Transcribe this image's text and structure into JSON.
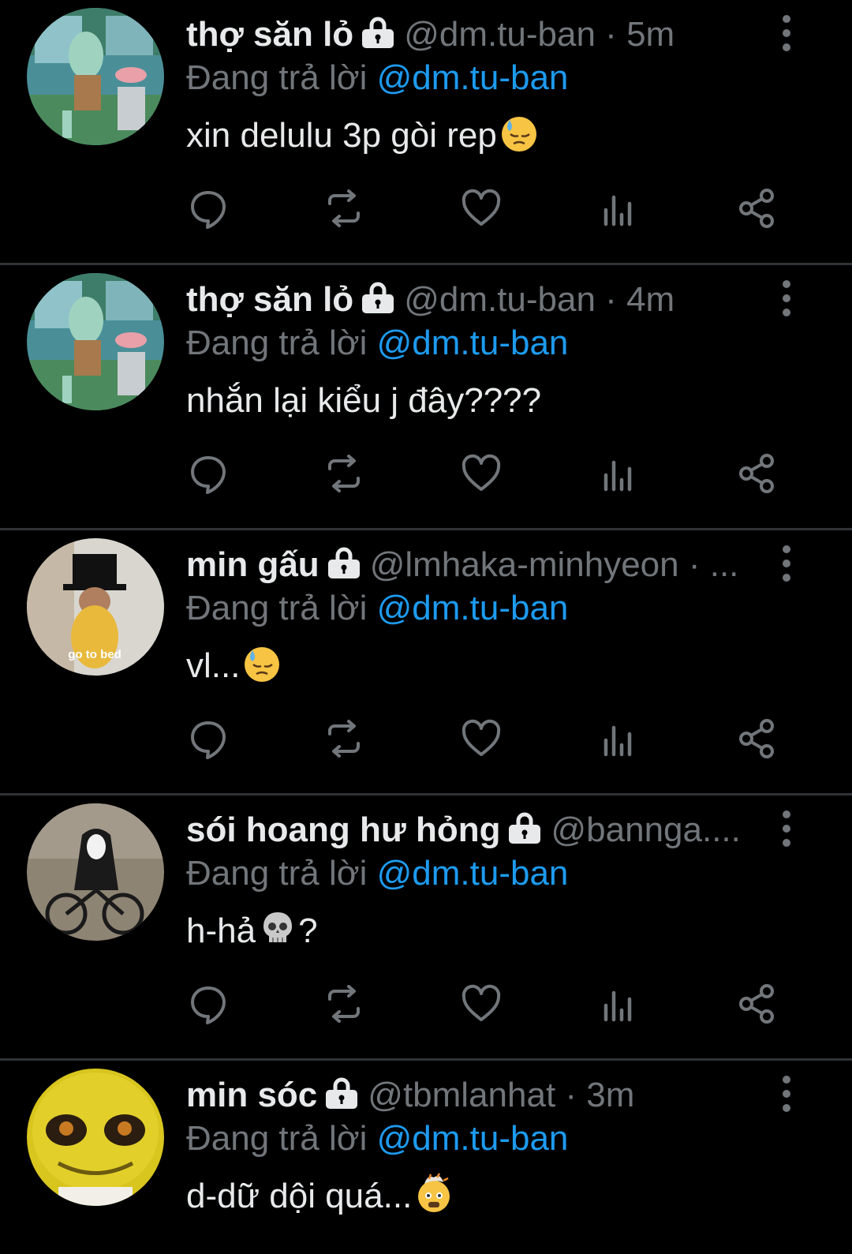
{
  "replying_prefix": "Đang trả lời ",
  "tweets": [
    {
      "name": "thợ săn lỏ",
      "handle_time": "@dm.tu-ban · 5m",
      "replying_to": "@dm.tu-ban",
      "text": "xin delulu 3p gòi rep",
      "emoji": "sad-sweat-face"
    },
    {
      "name": "thợ săn lỏ",
      "handle_time": "@dm.tu-ban · 4m",
      "replying_to": "@dm.tu-ban",
      "text": "nhắn lại kiểu j đây????",
      "emoji": ""
    },
    {
      "name": "min gấu",
      "handle_time": "@lmhaka-minhyeon · ...",
      "replying_to": "@dm.tu-ban",
      "text": "vl...",
      "emoji": "sad-sweat-face",
      "avatar_caption": "go to bed"
    },
    {
      "name": "sói hoang hư hỏng",
      "handle_time": "@bannga....",
      "replying_to": "@dm.tu-ban",
      "text": "h-hả",
      "text_after": "?",
      "emoji": "skull"
    },
    {
      "name": "min sóc",
      "handle_time": "@tbmlanhat · 3m",
      "replying_to": "@dm.tu-ban",
      "text": "d-dữ dội quá...",
      "emoji": "exploding-head"
    }
  ],
  "colors": {
    "background": "#000000",
    "text": "#e7e9ea",
    "secondary": "#71767b",
    "accent": "#1d9bf0",
    "divider": "#2f3336"
  }
}
